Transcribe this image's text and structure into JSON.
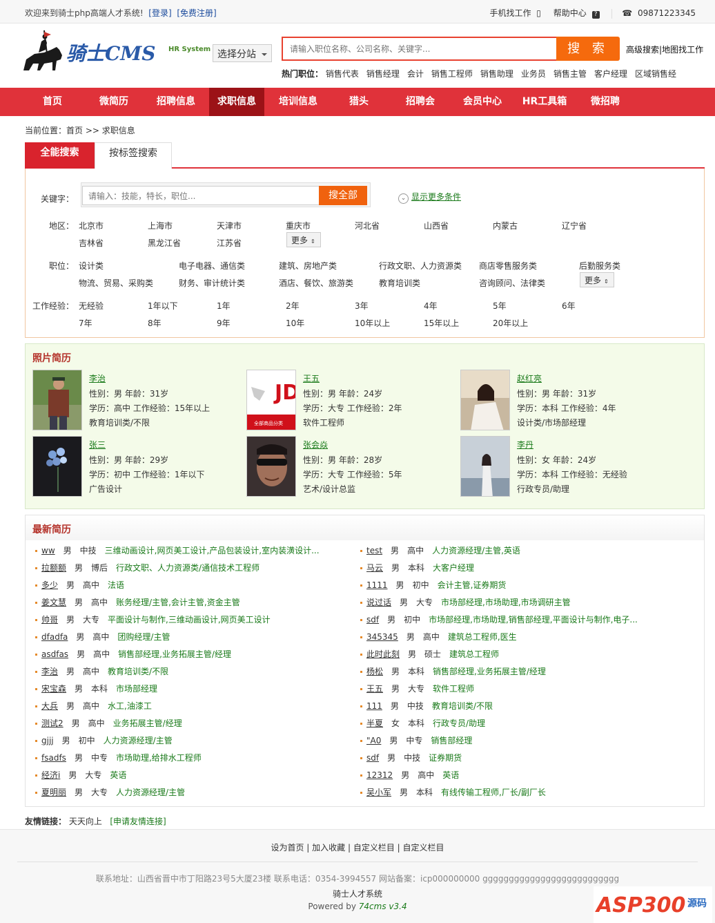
{
  "topbar": {
    "welcome": "欢迎来到骑士php高端人才系统!",
    "login": "[登录]",
    "register": "[免费注册]",
    "mobile": "手机找工作",
    "help": "帮助中心",
    "phone": "09871223345"
  },
  "header": {
    "logo_text": "骑士CMS",
    "logo_sub": "HR System",
    "branch_select": "选择分站",
    "search_placeholder": "请输入职位名称、公司名称、关键字...",
    "search_button": "搜 索",
    "adv_search": "高级搜索",
    "map_search": "地图找工作",
    "hot_label": "热门职位：",
    "hot_jobs": [
      "销售代表",
      "销售经理",
      "会计",
      "销售工程师",
      "销售助理",
      "业务员",
      "销售主管",
      "客户经理",
      "区域销售经"
    ]
  },
  "nav": [
    "首页",
    "微简历",
    "招聘信息",
    "求职信息",
    "培训信息",
    "猎头",
    "招聘会",
    "会员中心",
    "HR工具箱",
    "微招聘"
  ],
  "breadcrumb": "当前位置：首页 >> 求职信息",
  "tabs": {
    "all": "全能搜索",
    "tag": "按标签搜索"
  },
  "filters": {
    "keyword_label": "关键字：",
    "keyword_placeholder": "请输入：技能，特长，职位...",
    "search_all": "搜全部",
    "more_conditions": "显示更多条件",
    "area_label": "地区：",
    "areas": [
      "北京市",
      "上海市",
      "天津市",
      "重庆市",
      "河北省",
      "山西省",
      "内蒙古",
      "辽宁省",
      "吉林省",
      "黑龙江省",
      "江苏省"
    ],
    "more": "更多",
    "job_label": "职位：",
    "jobs": [
      "设计类",
      "电子电器、通信类",
      "建筑、房地产类",
      "行政文职、人力资源类",
      "商店零售服务类",
      "后勤服务类",
      "物流、贸易、采购类",
      "财务、审计统计类",
      "酒店、餐饮、旅游类",
      "教育培训类",
      "咨询顾问、法律类"
    ],
    "exp_label": "工作经验：",
    "exps": [
      "无经验",
      "1年以下",
      "1年",
      "2年",
      "3年",
      "4年",
      "5年",
      "6年",
      "7年",
      "8年",
      "9年",
      "10年",
      "10年以上",
      "15年以上",
      "20年以上"
    ]
  },
  "photo_resumes": {
    "title": "照片简历",
    "items": [
      {
        "name": "李治",
        "line1": "性别：男 年龄：31岁",
        "line2": "学历：高中 工作经验：15年以上",
        "line3": "教育培训类/不限"
      },
      {
        "name": "王五",
        "line1": "性别：男 年龄：24岁",
        "line2": "学历：大专 工作经验：2年",
        "line3": "软件工程师"
      },
      {
        "name": "赵红亮",
        "line1": "性别：男 年龄：31岁",
        "line2": "学历：本科 工作经验：4年",
        "line3": "设计类/市场部经理"
      },
      {
        "name": "张三",
        "line1": "性别：男 年龄：29岁",
        "line2": "学历：初中 工作经验：1年以下",
        "line3": "广告设计"
      },
      {
        "name": "张会焱",
        "line1": "性别：男 年龄：28岁",
        "line2": "学历：大专 工作经验：5年",
        "line3": "艺术/设计总监"
      },
      {
        "name": "李丹",
        "line1": "性别：女 年龄：24岁",
        "line2": "学历：本科 工作经验：无经验",
        "line3": "行政专员/助理"
      }
    ]
  },
  "latest": {
    "title": "最新简历",
    "left": [
      {
        "name": "ww",
        "sex": "男",
        "edu": "中技",
        "pos": "三维动画设计,网页美工设计,产品包装设计,室内装潢设计..."
      },
      {
        "name": "拉额额",
        "sex": "男",
        "edu": "博后",
        "pos": "行政文职、人力资源类/通信技术工程师"
      },
      {
        "name": "多少",
        "sex": "男",
        "edu": "高中",
        "pos": "法语"
      },
      {
        "name": "姜文慧",
        "sex": "男",
        "edu": "高中",
        "pos": "账务经理/主管,会计主管,资金主管"
      },
      {
        "name": "帅哥",
        "sex": "男",
        "edu": "大专",
        "pos": "平面设计与制作,三维动画设计,网页美工设计"
      },
      {
        "name": "dfadfa",
        "sex": "男",
        "edu": "高中",
        "pos": "团购经理/主管"
      },
      {
        "name": "asdfas",
        "sex": "男",
        "edu": "高中",
        "pos": "销售部经理,业务拓展主管/经理"
      },
      {
        "name": "李治",
        "sex": "男",
        "edu": "高中",
        "pos": "教育培训类/不限"
      },
      {
        "name": "宋宝森",
        "sex": "男",
        "edu": "本科",
        "pos": "市场部经理"
      },
      {
        "name": "大兵",
        "sex": "男",
        "edu": "高中",
        "pos": "水工,油漆工"
      },
      {
        "name": "测试2",
        "sex": "男",
        "edu": "高中",
        "pos": "业务拓展主管/经理"
      },
      {
        "name": "gjjj",
        "sex": "男",
        "edu": "初中",
        "pos": "人力资源经理/主管"
      },
      {
        "name": "fsadfs",
        "sex": "男",
        "edu": "中专",
        "pos": "市场助理,给排水工程师"
      },
      {
        "name": "经济i",
        "sex": "男",
        "edu": "大专",
        "pos": "英语"
      },
      {
        "name": "夏明丽",
        "sex": "男",
        "edu": "大专",
        "pos": "人力资源经理/主管"
      }
    ],
    "right": [
      {
        "name": "test",
        "sex": "男",
        "edu": "高中",
        "pos": "人力资源经理/主管,英语"
      },
      {
        "name": "马云",
        "sex": "男",
        "edu": "本科",
        "pos": "大客户经理"
      },
      {
        "name": "1111",
        "sex": "男",
        "edu": "初中",
        "pos": "会计主管,证券期货"
      },
      {
        "name": "说过话",
        "sex": "男",
        "edu": "大专",
        "pos": "市场部经理,市场助理,市场调研主管"
      },
      {
        "name": "sdf",
        "sex": "男",
        "edu": "初中",
        "pos": "市场部经理,市场助理,销售部经理,平面设计与制作,电子..."
      },
      {
        "name": "345345",
        "sex": "男",
        "edu": "高中",
        "pos": "建筑总工程师,医生"
      },
      {
        "name": "此时此刻",
        "sex": "男",
        "edu": "硕士",
        "pos": "建筑总工程师"
      },
      {
        "name": "杨松",
        "sex": "男",
        "edu": "本科",
        "pos": "销售部经理,业务拓展主管/经理"
      },
      {
        "name": "王五",
        "sex": "男",
        "edu": "大专",
        "pos": "软件工程师"
      },
      {
        "name": "111",
        "sex": "男",
        "edu": "中技",
        "pos": "教育培训类/不限"
      },
      {
        "name": "半夏",
        "sex": "女",
        "edu": "本科",
        "pos": "行政专员/助理"
      },
      {
        "name": "\"A0",
        "sex": "男",
        "edu": "中专",
        "pos": "销售部经理"
      },
      {
        "name": "sdf",
        "sex": "男",
        "edu": "中技",
        "pos": "证券期货"
      },
      {
        "name": "12312",
        "sex": "男",
        "edu": "高中",
        "pos": "英语"
      },
      {
        "name": "吴小军",
        "sex": "男",
        "edu": "本科",
        "pos": "有线传输工程师,厂长/副厂长"
      }
    ]
  },
  "friend_links": {
    "label": "友情链接：",
    "item": "天天向上",
    "apply": "[申请友情连接]"
  },
  "footer": {
    "links": "设为首页 | 加入收藏 | 自定义栏目 | 自定义栏目",
    "info": "联系地址：山西省晋中市丁阳路23号5大厦23楼 联系电话：0354-3994557 网站备案：icp000000000 gggggggggggggggggggggggggg",
    "site": "骑士人才系统",
    "powered_by": "Powered by",
    "powered_name": "74cms v3.4"
  },
  "watermark": {
    "text": "ASP300",
    "sub": "源码"
  },
  "colors": {
    "brand_red": "#e0323a",
    "nav_active": "#9c1217",
    "search_orange": "#f56a0d",
    "link_green": "#1a7a1a"
  }
}
